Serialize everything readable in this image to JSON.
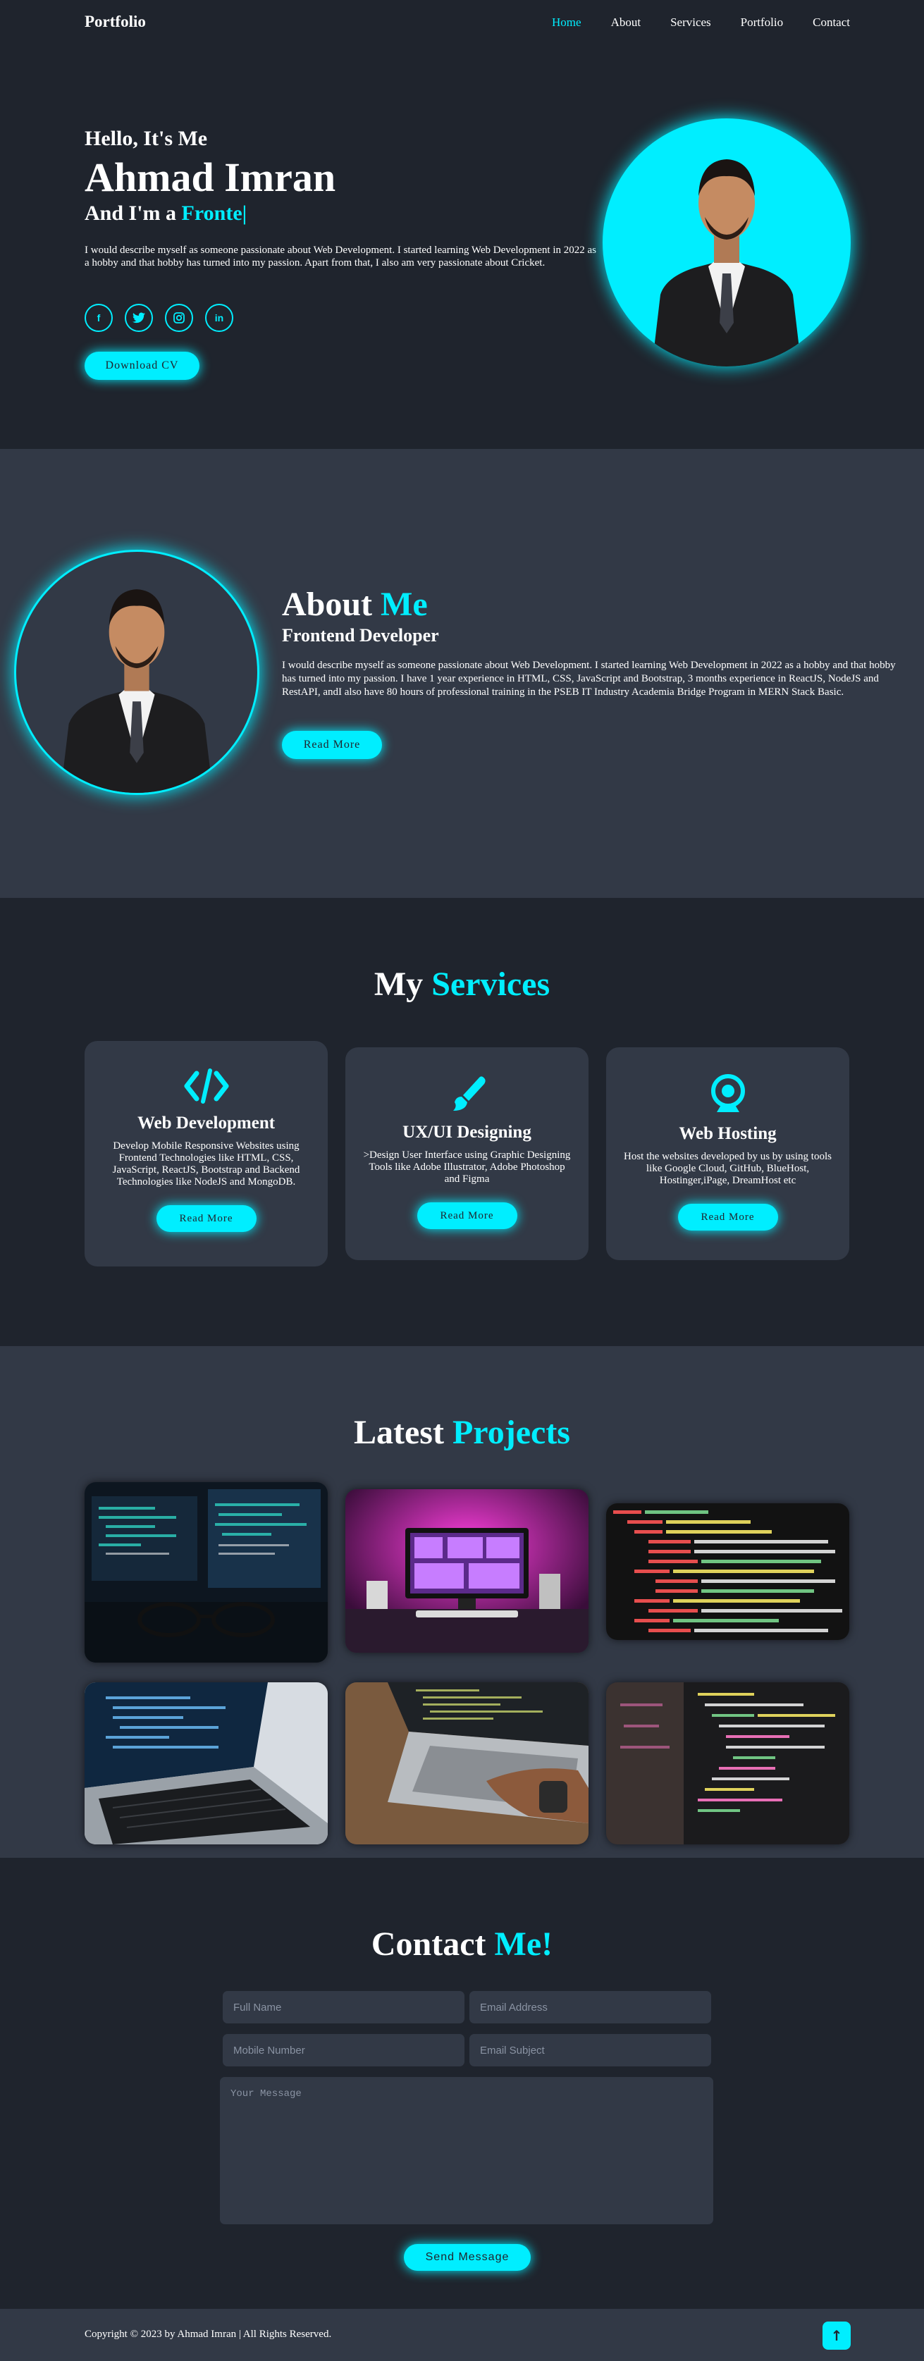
{
  "header": {
    "logo": "Portfolio",
    "nav": [
      "Home",
      "About",
      "Services",
      "Portfolio",
      "Contact"
    ],
    "active": "Home"
  },
  "home": {
    "greeting": "Hello, It's Me",
    "name": "Ahmad Imran",
    "role_prefix": "And I'm a ",
    "role_typed": "Fronte",
    "cursor": "|",
    "description": "I would describe myself as someone passionate about Web Development. I started learning Web Development in 2022 as a hobby and that hobby has turned into my passion. Apart from that, I also am very passionate about Cricket.",
    "socials": [
      {
        "icon": "facebook-icon",
        "glyph": "f"
      },
      {
        "icon": "twitter-icon",
        "glyph": "t"
      },
      {
        "icon": "instagram-icon",
        "glyph": "◎"
      },
      {
        "icon": "linkedin-icon",
        "glyph": "in"
      }
    ],
    "cta": "Download CV"
  },
  "about": {
    "title": "About ",
    "title_accent": "Me",
    "subtitle": "Frontend Developer",
    "description": "I would describe myself as someone passionate about Web Development. I started learning Web Development in 2022 as a hobby and that hobby has turned into my passion. I have 1 year experience in HTML, CSS, JavaScript and Bootstrap, 3 months experience in ReactJS, NodeJS and RestAPI, andI also have 80 hours of professional training in the PSEB IT Industry Academia Bridge Program in MERN Stack Basic.",
    "cta": "Read More"
  },
  "services": {
    "title": "My ",
    "title_accent": "Services",
    "cards": [
      {
        "icon": "code-icon",
        "title": "Web Development",
        "text": "Develop Mobile Responsive Websites using Frontend Technologies like HTML, CSS, JavaScript, ReactJS, Bootstrap and Backend Technologies like NodeJS and MongoDB.",
        "cta": "Read More"
      },
      {
        "icon": "paintbrush-icon",
        "title": "UX/UI Designing",
        "text": ">Design User Interface using Graphic Designing Tools like Adobe Illustrator, Adobe Photoshop and Figma",
        "cta": "Read More"
      },
      {
        "icon": "webcam-icon",
        "title": "Web Hosting",
        "text": "Host the websites developed by us by using tools like Google Cloud, GitHub, BlueHost, Hostinger,iPage, DreamHost etc",
        "cta": "Read More"
      }
    ]
  },
  "projects": {
    "title": "Latest ",
    "title_accent": "Projects",
    "images": [
      "monitors-glasses-image",
      "pink-desk-setup-image",
      "code-editor-image",
      "laptop-code-image",
      "laptop-typing-image",
      "code-screen-image"
    ]
  },
  "contact": {
    "title": "Contact ",
    "title_accent": "Me!",
    "placeholders": {
      "full_name": "Full Name",
      "email": "Email Address",
      "mobile": "Mobile Number",
      "subject": "Email Subject",
      "message": "Your Message"
    },
    "submit": "Send Message"
  },
  "footer": {
    "copyright": "Copyright © 2023 by Ahmad Imran | All Rights Reserved.",
    "top_icon": "arrow-up-icon"
  },
  "colors": {
    "accent": "#00eeff",
    "bg": "#1f242d",
    "bg_alt": "#323946"
  }
}
